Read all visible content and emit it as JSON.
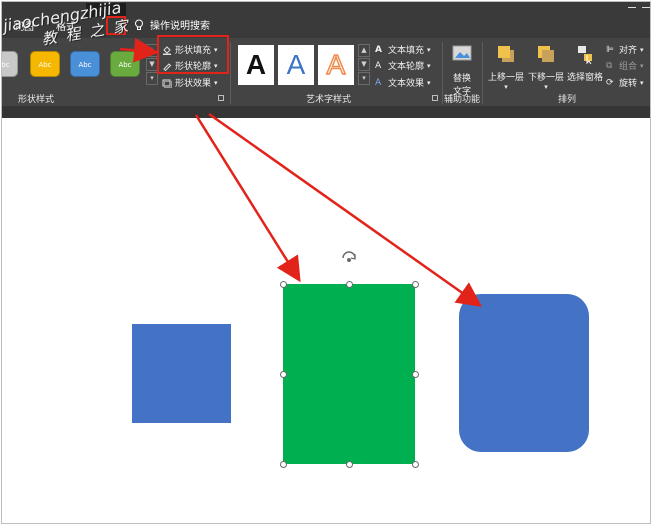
{
  "tabs": {
    "view": "视图",
    "format_partial": "格式",
    "tell_me": "操作说明搜索"
  },
  "shape_styles": {
    "samples": [
      {
        "label": "Abc",
        "color": "#c8c8c8"
      },
      {
        "label": "Abc",
        "color": "#f5b700"
      },
      {
        "label": "Abc",
        "color": "#4a90d9"
      },
      {
        "label": "Abc",
        "color": "#6aab3f"
      }
    ],
    "fill": "形状填充",
    "outline": "形状轮廓",
    "effects": "形状效果",
    "group_label": "形状样式"
  },
  "wordart": {
    "samples": [
      {
        "letter": "A",
        "color": "#111111"
      },
      {
        "letter": "A",
        "color": "#3e74c4"
      },
      {
        "letter": "A",
        "color": "#f08a4b"
      }
    ],
    "text_fill": "文本填充",
    "text_outline": "文本轮廓",
    "text_effects": "文本效果",
    "group_label": "艺术字样式"
  },
  "accessibility": {
    "alt_text_line1": "替换",
    "alt_text_line2": "文字",
    "group_label": "辅助功能"
  },
  "arrange": {
    "bring_forward": "上移一层",
    "send_backward": "下移一层",
    "selection_pane": "选择窗格",
    "align": "对齐",
    "group": "组合",
    "rotate": "旋转",
    "group_label": "排列"
  },
  "watermark": {
    "line1": "jiaochengzhijia",
    "line2": "教程之家"
  },
  "colors": {
    "ribbon": "#444444",
    "blue_shape": "#4472c4",
    "green_shape": "#00b050",
    "highlight": "#e2231a"
  }
}
